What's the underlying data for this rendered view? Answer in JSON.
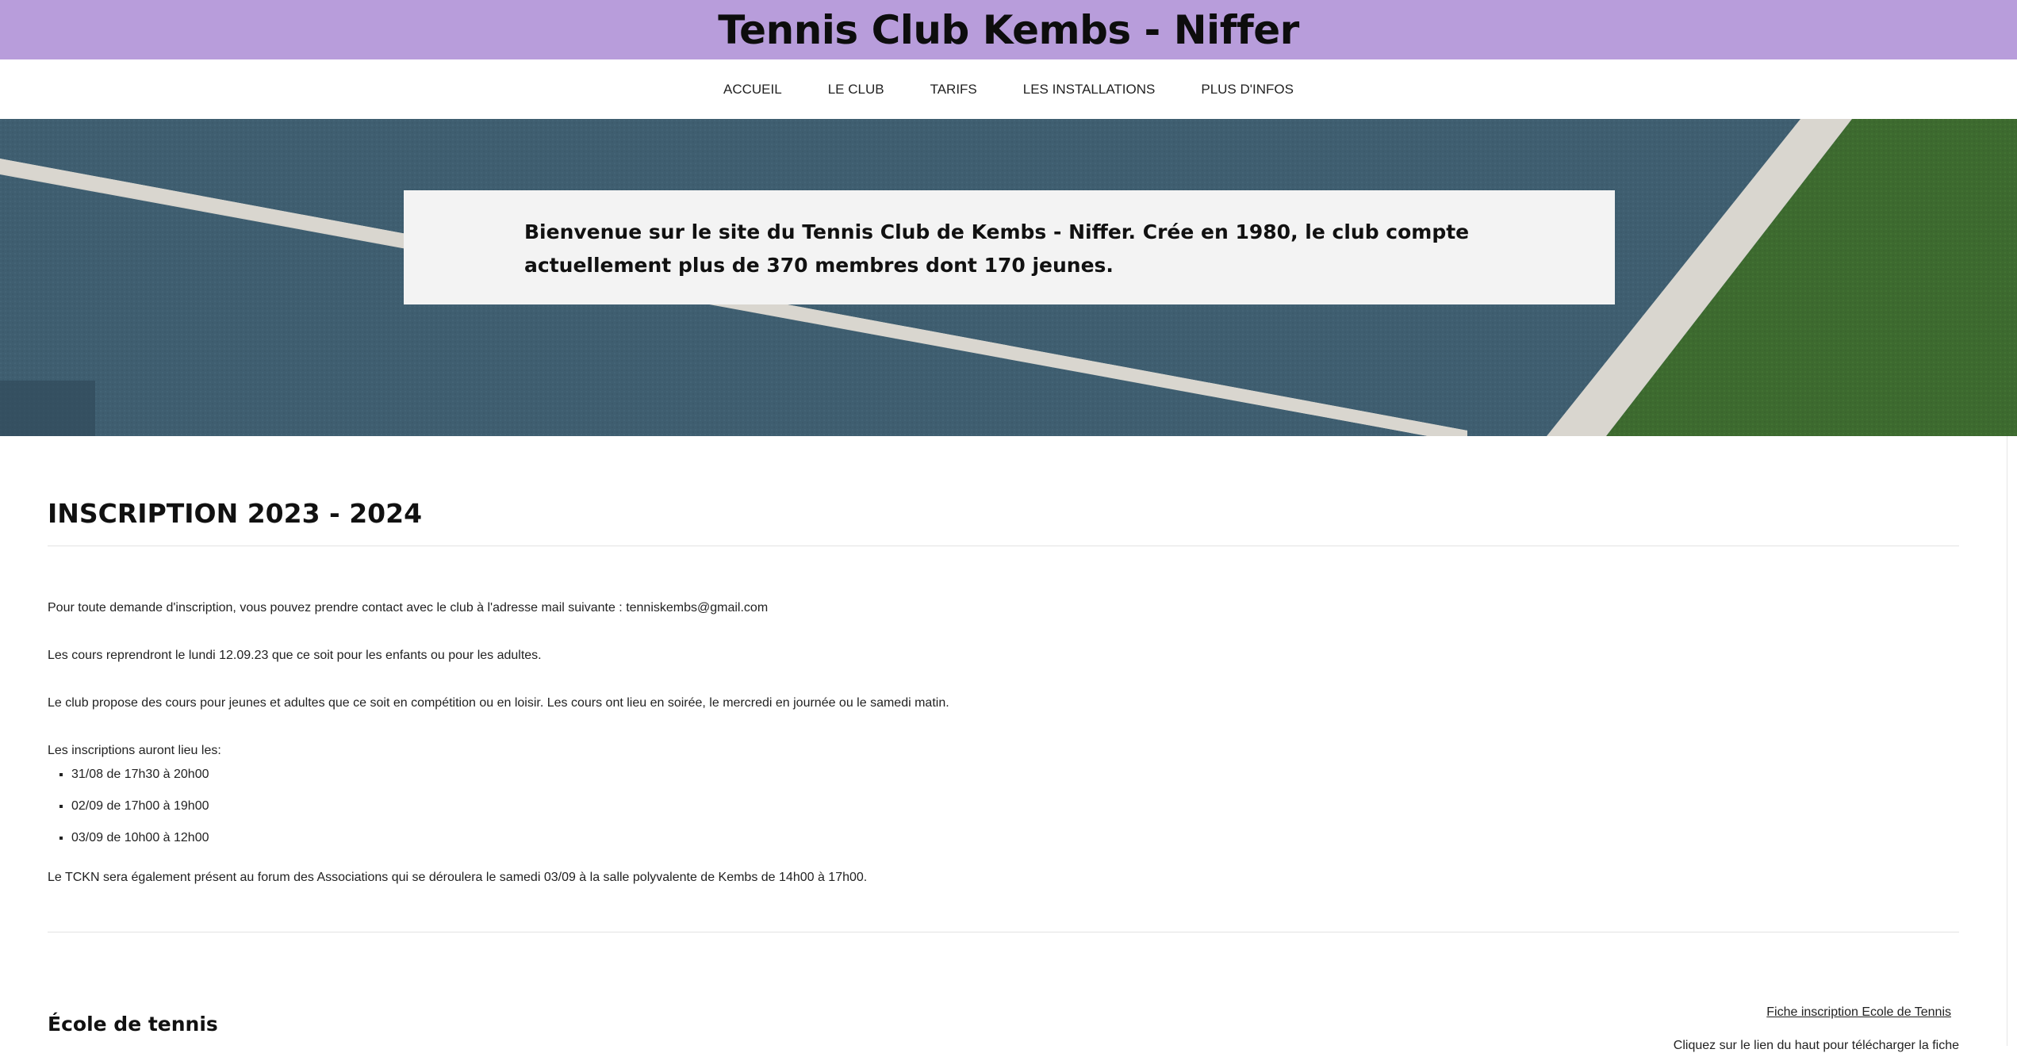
{
  "header": {
    "title": "Tennis Club Kembs - Niffer"
  },
  "nav": {
    "items": [
      {
        "label": "ACCUEIL"
      },
      {
        "label": "LE CLUB"
      },
      {
        "label": "TARIFS"
      },
      {
        "label": "LES INSTALLATIONS"
      },
      {
        "label": "PLUS D'INFOS"
      }
    ]
  },
  "hero": {
    "welcome_text": "Bienvenue sur le site du Tennis Club de Kembs - Niffer. Crée en 1980, le club compte actuellement plus de 370 membres dont 170 jeunes.",
    "colors": {
      "court_blue": "#3f5e70",
      "court_green": "#3d6a2f",
      "line_white": "#d9d6cf"
    }
  },
  "main": {
    "section_title": "INSCRIPTION 2023 - 2024",
    "paragraphs": [
      "Pour toute demande d'inscription, vous pouvez prendre contact avec le club à l'adresse mail suivante : tenniskembs@gmail.com",
      "Les cours reprendront le lundi 12.09.23 que ce soit pour les enfants ou pour les adultes.",
      "Le club propose des cours pour jeunes et adultes que ce soit en compétition ou en loisir. Les cours ont lieu en soirée, le mercredi en journée ou le samedi matin.",
      "Les inscriptions auront lieu les:"
    ],
    "dates": [
      "31/08 de 17h30 à 20h00",
      "02/09 de 17h00 à 19h00",
      "03/09 de 10h00 à 12h00"
    ],
    "forum_text": "Le TCKN sera également présent au forum des Associations qui se déroulera le samedi 03/09 à la salle polyvalente de Kembs de 14h00 à 17h00.",
    "ecole_title": "École de tennis",
    "fiche_link": "Fiche inscription Ecole de Tennis",
    "fiche_note": "Cliquez sur le lien du haut pour télécharger la fiche"
  },
  "theme": {
    "header_bg": "#b89ddb"
  }
}
